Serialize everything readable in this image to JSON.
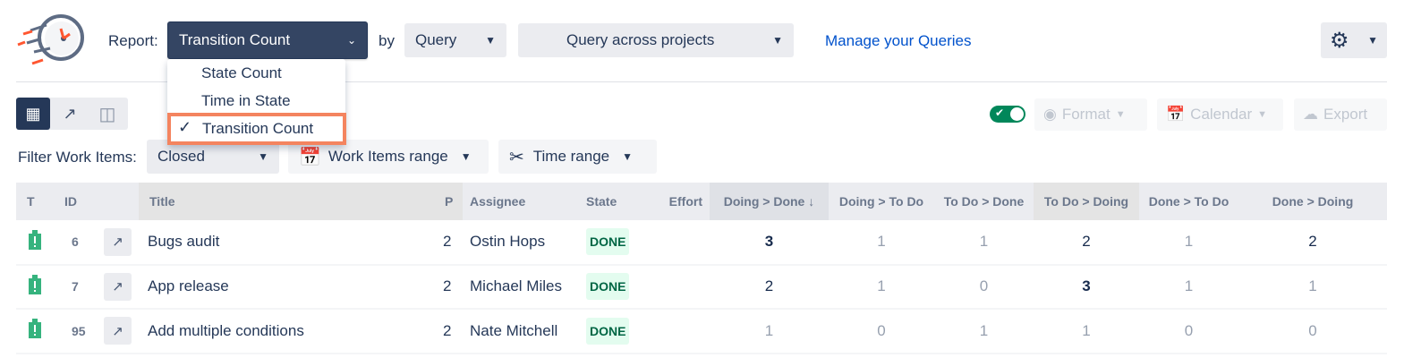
{
  "header": {
    "report_label": "Report:",
    "report_value": "Transition Count",
    "by_label": "by",
    "by_value": "Query",
    "query_value": "Query across projects",
    "manage_link": "Manage your Queries"
  },
  "report_menu": {
    "items": [
      {
        "label": "State Count",
        "selected": false
      },
      {
        "label": "Time in State",
        "selected": false
      },
      {
        "label": "Transition Count",
        "selected": true
      }
    ]
  },
  "toolbar": {
    "toggle_on": true,
    "format_label": "Format",
    "calendar_label": "Calendar",
    "export_label": "Export",
    "views": [
      "grid-icon",
      "chart-line-icon",
      "layout-icon"
    ],
    "active_view": "grid-icon"
  },
  "filters": {
    "label": "Filter Work Items:",
    "status_value": "Closed",
    "work_items_range": "Work Items range",
    "time_range": "Time range"
  },
  "table": {
    "columns": [
      "T",
      "ID",
      "",
      "Title",
      "P",
      "Assignee",
      "State",
      "Effort",
      "Doing > Done",
      "Doing > To Do",
      "To Do > Done",
      "To Do > Doing",
      "Done > To Do",
      "Done > Doing"
    ],
    "sorted_column": "Doing > Done",
    "rows": [
      {
        "id": "6",
        "title": "Bugs audit",
        "p": "2",
        "assignee": "Ostin Hops",
        "state": "DONE",
        "effort": "",
        "values": [
          3,
          1,
          1,
          2,
          1,
          2
        ]
      },
      {
        "id": "7",
        "title": "App release",
        "p": "2",
        "assignee": "Michael Miles",
        "state": "DONE",
        "effort": "",
        "values": [
          2,
          1,
          0,
          3,
          1,
          1
        ]
      },
      {
        "id": "95",
        "title": "Add multiple conditions",
        "p": "2",
        "assignee": "Nate Mitchell",
        "state": "DONE",
        "effort": "",
        "values": [
          1,
          0,
          1,
          1,
          0,
          0
        ]
      }
    ]
  },
  "colors": {
    "accent": "#344563",
    "highlight": "#f4845f",
    "toggle": "#00875a",
    "link": "#0052cc",
    "bug": "#36b37e"
  }
}
